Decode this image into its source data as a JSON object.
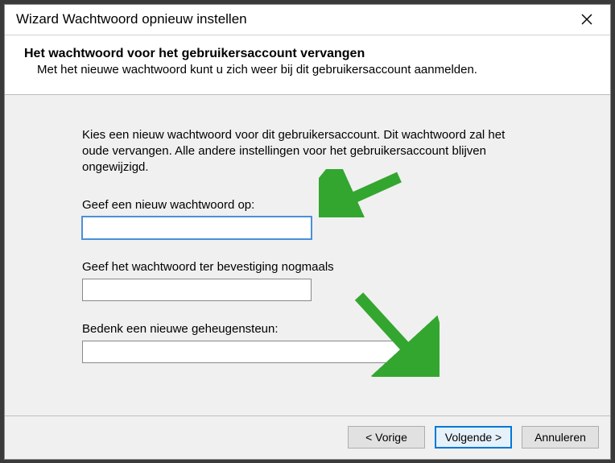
{
  "titlebar": {
    "title": "Wizard Wachtwoord opnieuw instellen"
  },
  "header": {
    "heading": "Het wachtwoord voor het gebruikersaccount vervangen",
    "subheading": "Met het nieuwe wachtwoord kunt u zich weer bij dit gebruikersaccount aanmelden."
  },
  "content": {
    "intro": "Kies een nieuw wachtwoord voor dit gebruikersaccount. Dit wachtwoord zal het oude vervangen. Alle andere instellingen voor het gebruikersaccount blijven ongewijzigd.",
    "new_password_label": "Geef een nieuw wachtwoord op:",
    "new_password_value": "",
    "confirm_password_label": "Geef het wachtwoord ter bevestiging nogmaals",
    "confirm_password_value": "",
    "hint_label": "Bedenk een nieuwe geheugensteun:",
    "hint_value": ""
  },
  "footer": {
    "back": "< Vorige",
    "next": "Volgende >",
    "cancel": "Annuleren"
  },
  "colors": {
    "accent": "#33a62f"
  }
}
